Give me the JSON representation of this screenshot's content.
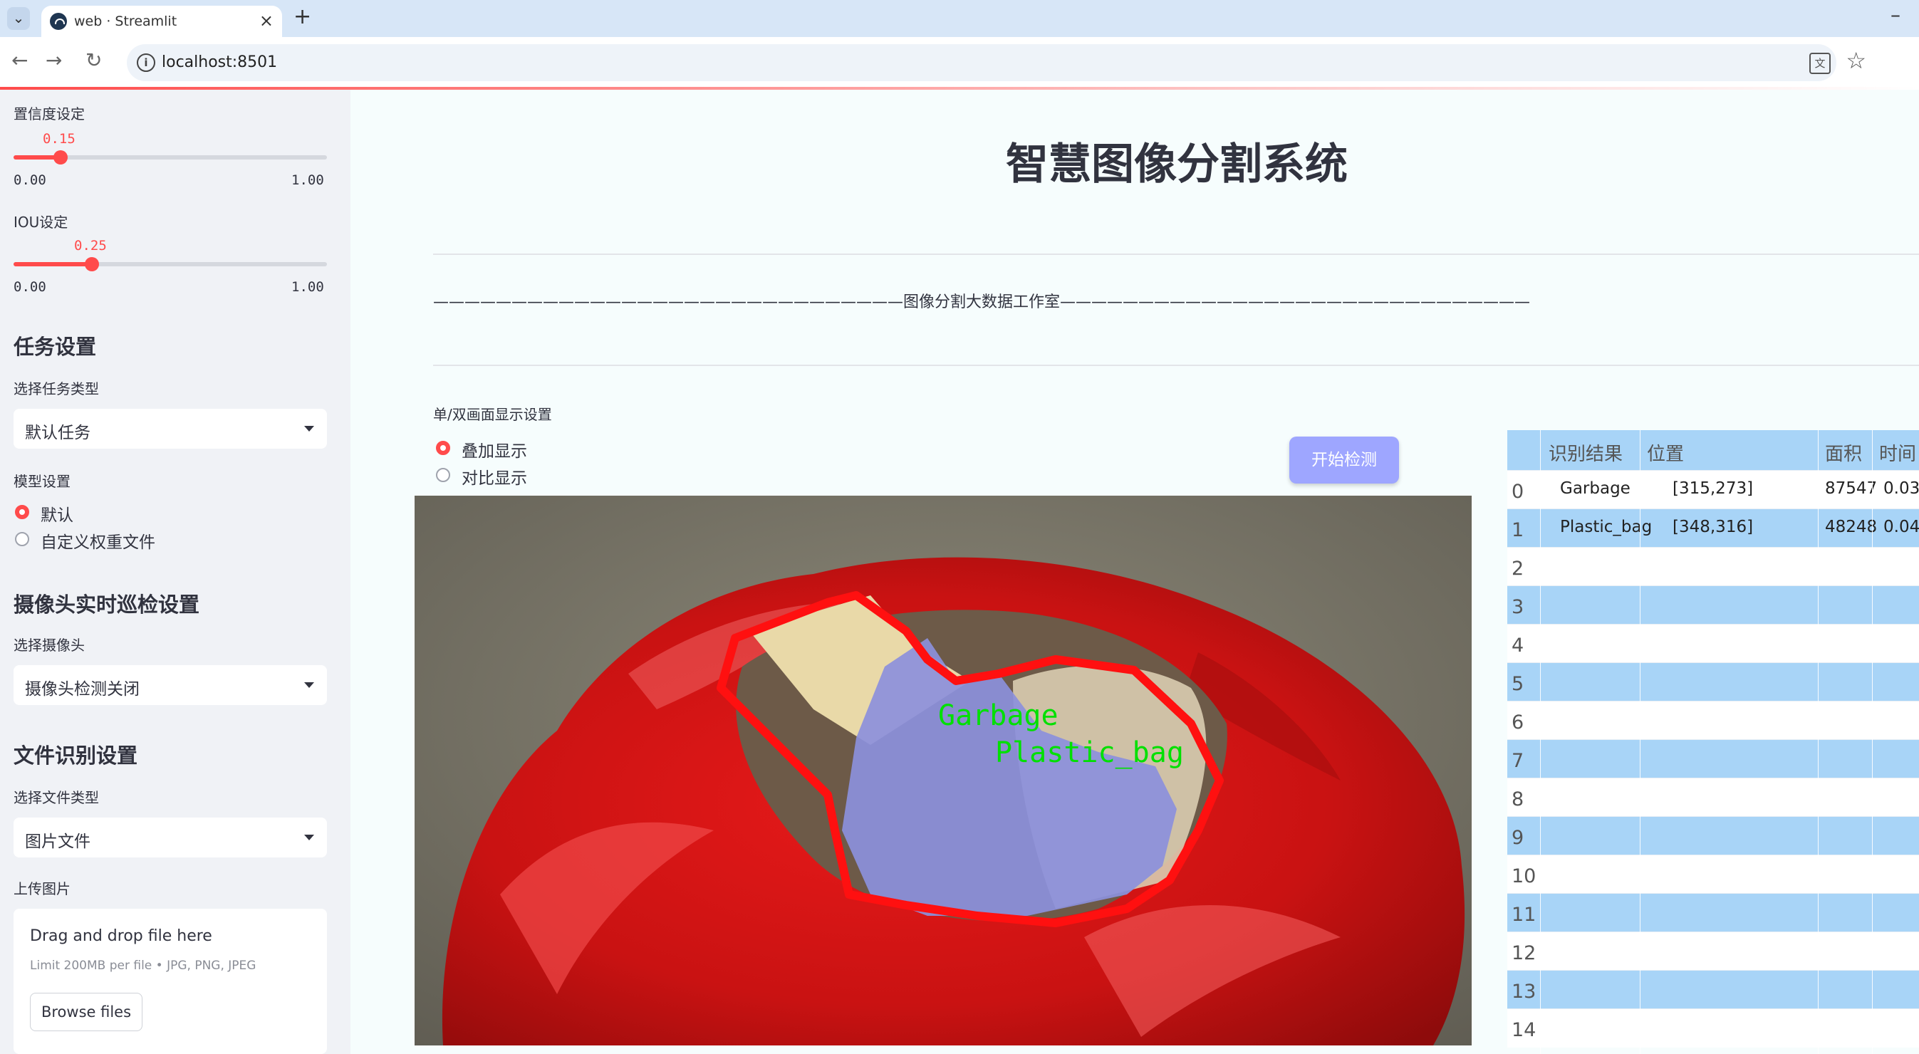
{
  "browser": {
    "tab_title": "web · Streamlit",
    "url": "localhost:8501",
    "new_tab": "+",
    "close": "×",
    "minimize": "–",
    "back": "←",
    "forward": "→",
    "reload": "↻",
    "tab_list": "⌄",
    "star": "☆",
    "info": "i",
    "translate": "文"
  },
  "sidebar": {
    "confidence": {
      "label": "置信度设定",
      "value": "0.15",
      "value_fraction": 0.15,
      "min": "0.00",
      "max": "1.00"
    },
    "iou": {
      "label": "IOU设定",
      "value": "0.25",
      "value_fraction": 0.25,
      "min": "0.00",
      "max": "1.00"
    },
    "task_header": "任务设置",
    "task_type_label": "选择任务类型",
    "task_type_value": "默认任务",
    "model_label": "模型设置",
    "model_options": [
      "默认",
      "自定义权重文件"
    ],
    "model_selected_index": 0,
    "camera_header": "摄像头实时巡检设置",
    "camera_label": "选择摄像头",
    "camera_value": "摄像头检测关闭",
    "file_header": "文件识别设置",
    "file_type_label": "选择文件类型",
    "file_type_value": "图片文件",
    "upload_label": "上传图片",
    "upload_drag": "Drag and drop file here",
    "upload_limit": "Limit 200MB per file • JPG, PNG, JPEG",
    "upload_button": "Browse files"
  },
  "main": {
    "title": "智慧图像分割系统",
    "divider": "——————————————————————————————图像分割大数据工作室——————————————————————————————",
    "display_label": "单/双画面显示设置",
    "display_options": [
      "叠加显示",
      "对比显示"
    ],
    "display_selected_index": 0,
    "start_button": "开始检测",
    "detections": [
      {
        "label": "Garbage",
        "color": "#00e000"
      },
      {
        "label": "Plastic_bag",
        "color": "#00e000"
      }
    ]
  },
  "table": {
    "columns": [
      "识别结果",
      "位置",
      "面积",
      "时间"
    ],
    "row_indices": [
      "0",
      "1",
      "2",
      "3",
      "4",
      "5",
      "6",
      "7",
      "8",
      "9",
      "10",
      "11",
      "12",
      "13",
      "14"
    ],
    "rows": [
      {
        "result": "Garbage",
        "position": "[315,273]",
        "area": "87547",
        "time": "0.03"
      },
      {
        "result": "Plastic_bag",
        "position": "[348,316]",
        "area": "48248",
        "time": "0.04"
      }
    ]
  },
  "colors": {
    "accent": "#ff4b4b",
    "button": "#9ea6ff",
    "table_stripe": "#a8d4f7",
    "sidebar_bg": "#f0f2f6"
  }
}
